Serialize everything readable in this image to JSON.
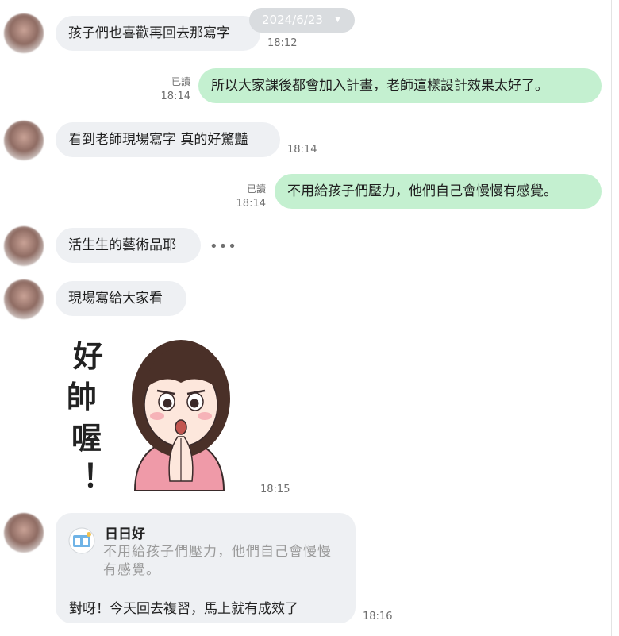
{
  "date_chip": {
    "label": "2024/6/23"
  },
  "messages": [
    {
      "text": "孩子們也喜歡再回去那寫字",
      "time": "18:12"
    },
    {
      "text": "所以大家課後都會加入計畫，老師這樣設計效果太好了。",
      "time": "18:14",
      "read": "已讀"
    },
    {
      "text": "看到老師現場寫字 真的好驚豔",
      "time": "18:14"
    },
    {
      "text": "不用給孩子們壓力，他們自己會慢慢有感覺。",
      "time": "18:14",
      "read": "已讀"
    },
    {
      "text": "活生生的藝術品耶"
    },
    {
      "text": "現場寫給大家看"
    },
    {
      "time": "18:15"
    },
    {
      "time": "18:16"
    }
  ],
  "sticker": {
    "caption": "好帥喔！"
  },
  "quote": {
    "name": "日日好",
    "quoted_text": "不用給孩子們壓力，他們自己會慢慢有感覺。",
    "reply": "對呀！今天回去複習，馬上就有成效了"
  },
  "colors": {
    "incoming_bubble": "#eef0f3",
    "outgoing_bubble": "#c4f0d0",
    "date_chip": "#d9dcdf"
  }
}
